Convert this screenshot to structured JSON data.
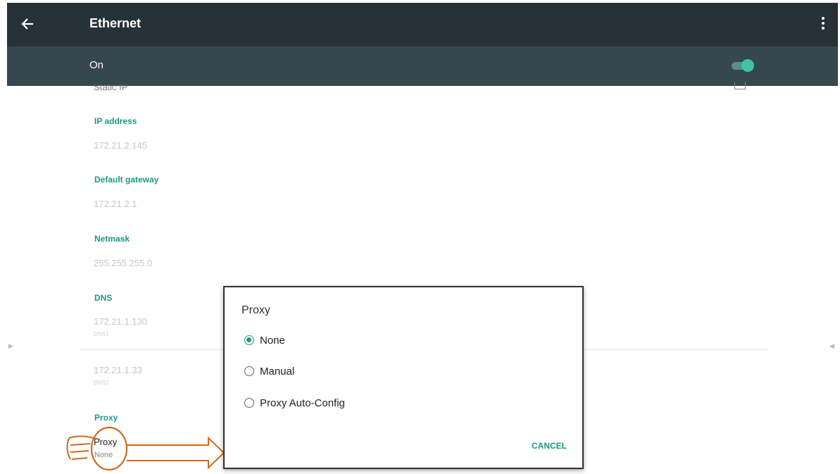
{
  "appbar": {
    "title": "Ethernet",
    "back_icon": "arrow-left-icon",
    "menu_icon": "more-vert-icon"
  },
  "switch_bar": {
    "label": "On",
    "state": "on",
    "accent": "#3ec3a8"
  },
  "static_ip": {
    "label": "Static IP"
  },
  "fields": {
    "ip_address": {
      "label": "IP address",
      "value": "172.21.2.145"
    },
    "default_gateway": {
      "label": "Default gateway",
      "value": "172.21.2.1"
    },
    "netmask": {
      "label": "Netmask",
      "value": "255.255.255.0"
    },
    "dns": {
      "label": "DNS",
      "dns1": "172.21.1.130",
      "dns1_sub": "DNS1",
      "dns2": "172.21.1.33",
      "dns2_sub": "DNS2"
    },
    "proxy_section": {
      "label": "Proxy",
      "item_title": "Proxy",
      "item_value": "None"
    }
  },
  "dialog": {
    "title": "Proxy",
    "options": [
      {
        "label": "None",
        "selected": true
      },
      {
        "label": "Manual",
        "selected": false
      },
      {
        "label": "Proxy Auto-Config",
        "selected": false
      }
    ],
    "cancel_label": "CANCEL"
  },
  "colors": {
    "appbar": "#263238",
    "switch_bar": "#37474f",
    "accent": "#1a9a86",
    "annotation": "#d2691e"
  }
}
